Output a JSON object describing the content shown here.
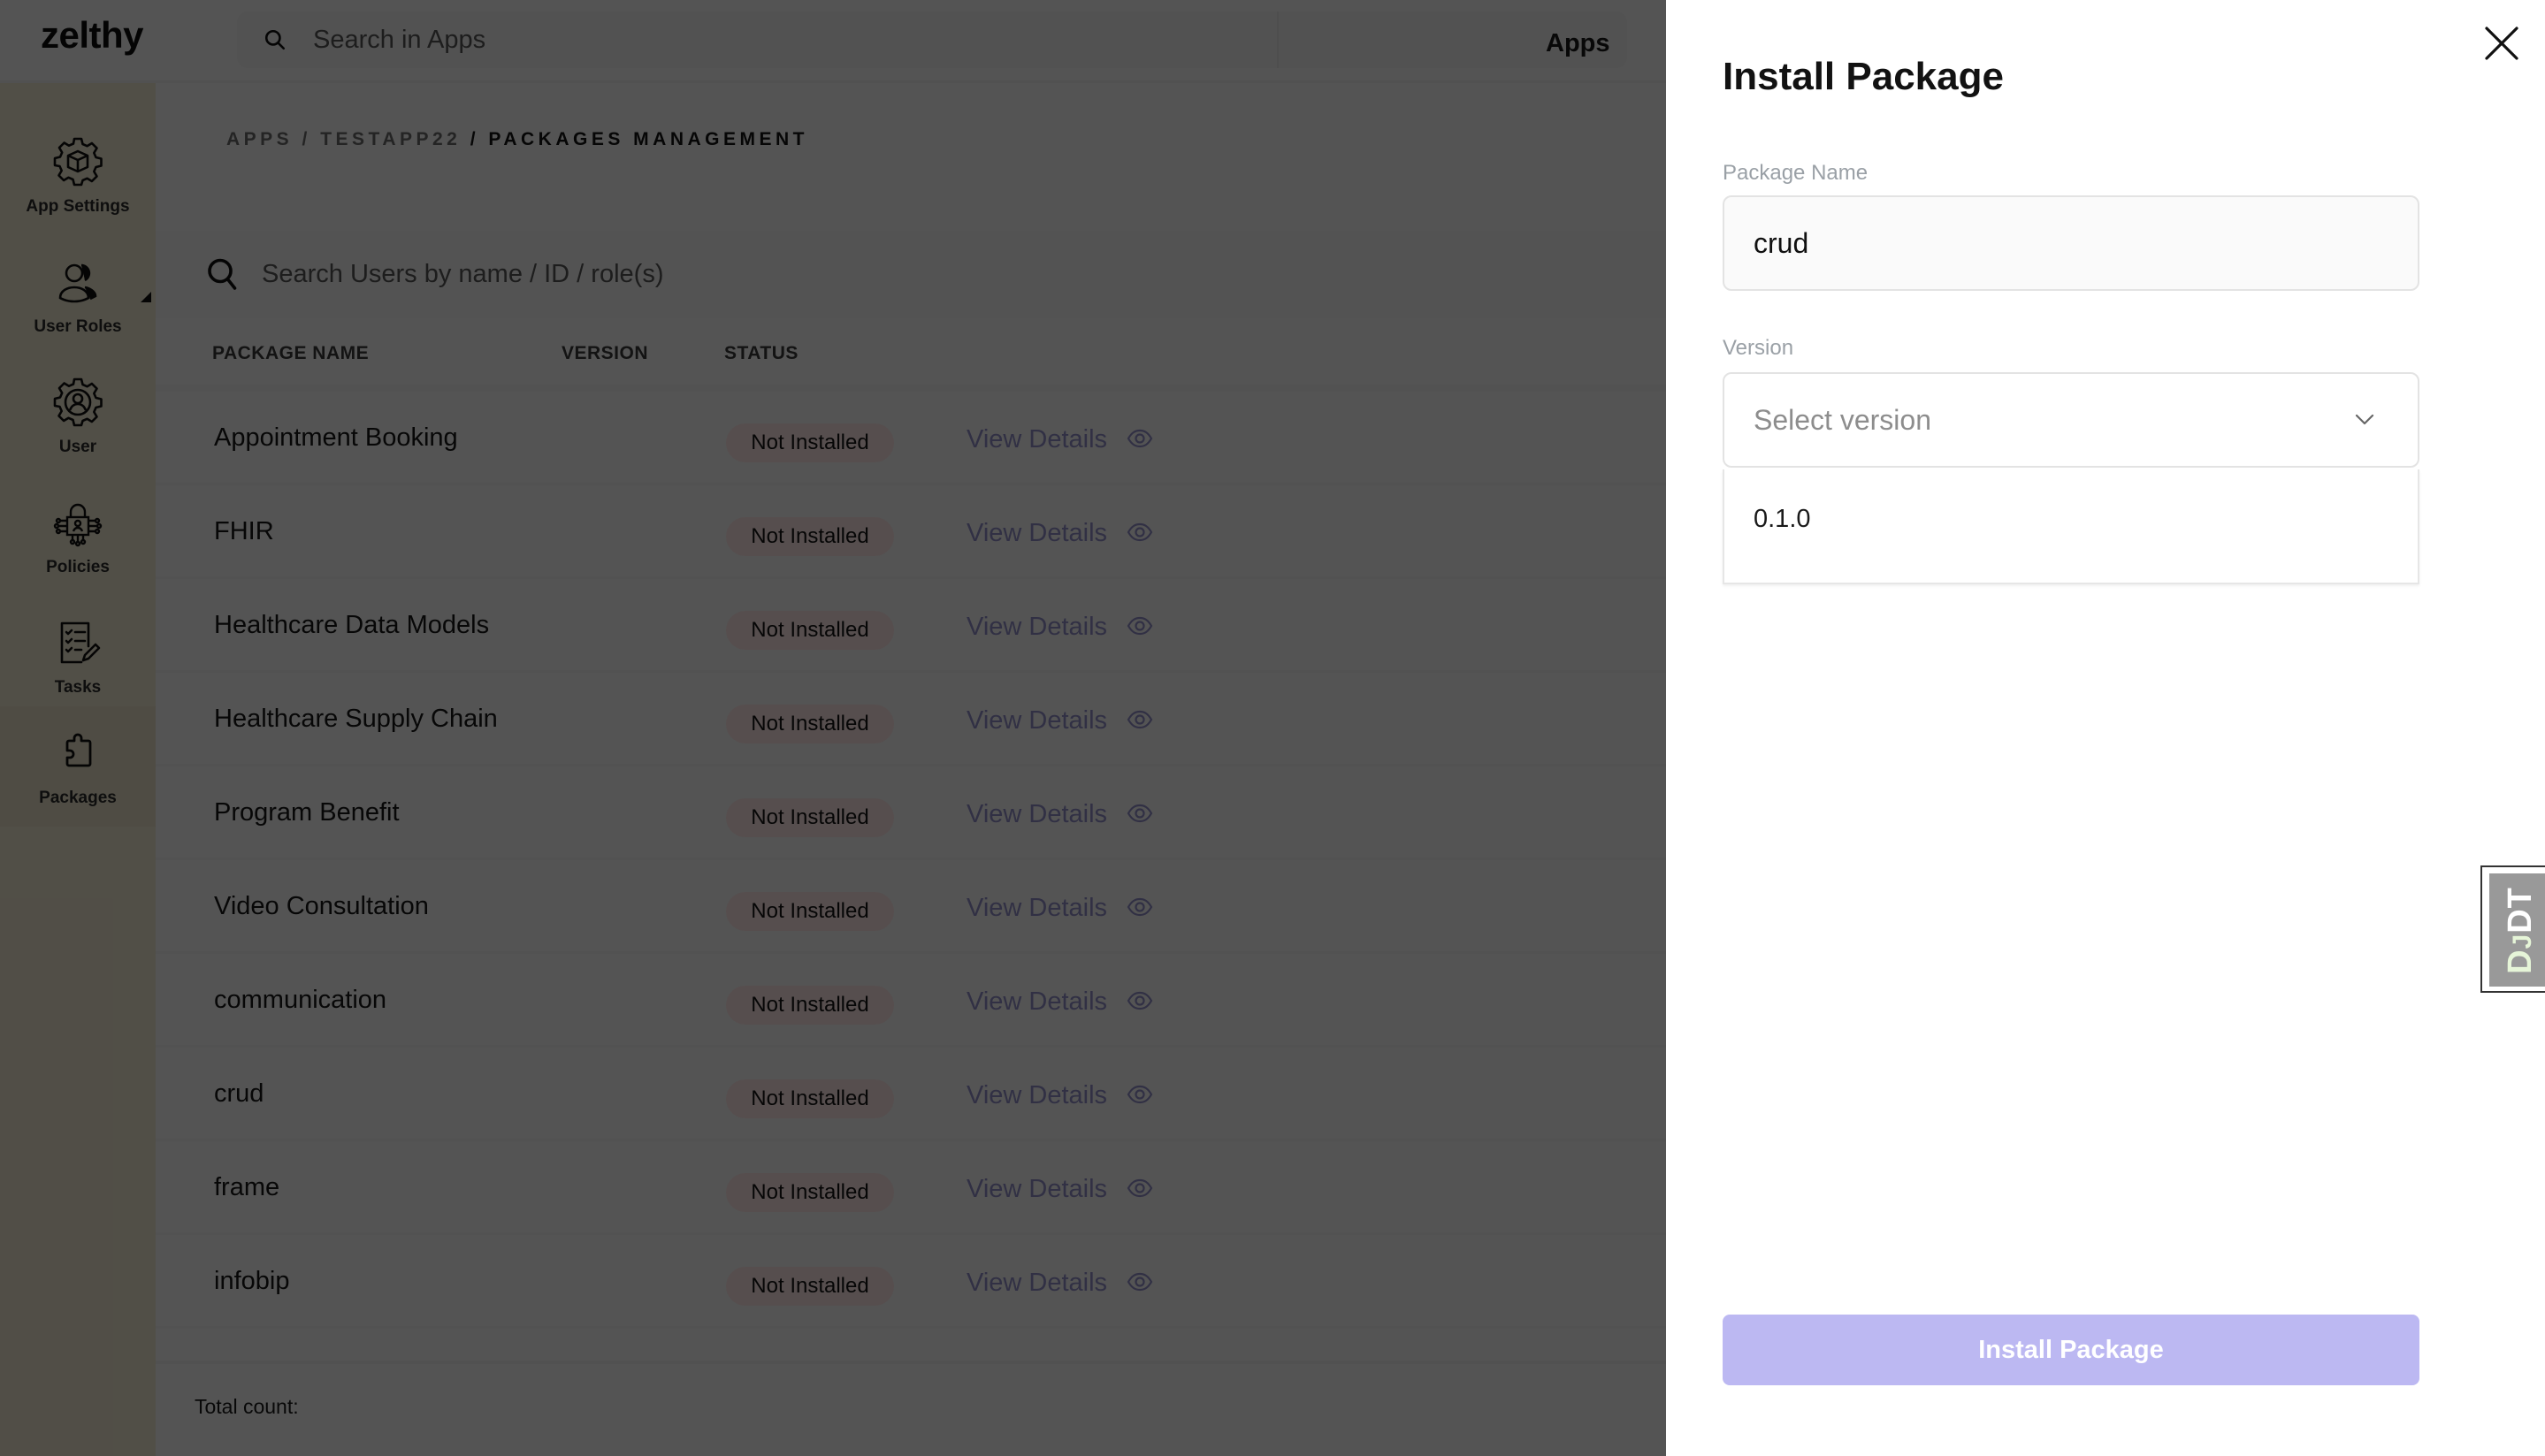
{
  "header": {
    "logo": "zelthy",
    "search_placeholder": "Search in Apps",
    "search_icon": "search-icon",
    "app_selector": {
      "value": "Apps",
      "icon": "chevron-down-icon"
    }
  },
  "sidebar": {
    "items": [
      {
        "label": "App Settings",
        "icon": "gear-cube-icon",
        "active": false
      },
      {
        "label": "User Roles",
        "icon": "user-roles-icon",
        "active": false
      },
      {
        "label": "User",
        "icon": "user-gear-icon",
        "active": false
      },
      {
        "label": "Policies",
        "icon": "policy-lock-icon",
        "active": false
      },
      {
        "label": "Tasks",
        "icon": "tasks-checklist-icon",
        "active": false
      },
      {
        "label": "Packages",
        "icon": "puzzle-piece-icon",
        "active": true
      }
    ]
  },
  "breadcrumb": {
    "items": [
      "APPS",
      "TESTAPP22"
    ],
    "separator": " / ",
    "current": "PACKAGES MANAGEMENT"
  },
  "table": {
    "search_placeholder": "Search Users by name / ID / role(s)",
    "columns": [
      "PACKAGE NAME",
      "VERSION",
      "STATUS"
    ],
    "rows": [
      {
        "name": "Appointment Booking",
        "version": "",
        "status": "Not Installed",
        "action": "View Details"
      },
      {
        "name": "FHIR",
        "version": "",
        "status": "Not Installed",
        "action": "View Details"
      },
      {
        "name": "Healthcare Data Models",
        "version": "",
        "status": "Not Installed",
        "action": "View Details"
      },
      {
        "name": "Healthcare Supply Chain",
        "version": "",
        "status": "Not Installed",
        "action": "View Details"
      },
      {
        "name": "Program Benefit",
        "version": "",
        "status": "Not Installed",
        "action": "View Details"
      },
      {
        "name": "Video Consultation",
        "version": "",
        "status": "Not Installed",
        "action": "View Details"
      },
      {
        "name": "communication",
        "version": "",
        "status": "Not Installed",
        "action": "View Details"
      },
      {
        "name": "crud",
        "version": "",
        "status": "Not Installed",
        "action": "View Details"
      },
      {
        "name": "frame",
        "version": "",
        "status": "Not Installed",
        "action": "View Details"
      },
      {
        "name": "infobip",
        "version": "",
        "status": "Not Installed",
        "action": "View Details"
      }
    ],
    "total_count_label": "Total count:"
  },
  "drawer": {
    "title": "Install Package",
    "package_name_label": "Package Name",
    "package_name_value": "crud",
    "version_label": "Version",
    "version_placeholder": "Select version",
    "version_options": [
      "0.1.0"
    ],
    "install_button": "Install Package",
    "close_icon": "close-icon"
  },
  "debug_toolbar": {
    "label_d": "D",
    "label_j": "J",
    "label_dt": "DT"
  },
  "colors": {
    "accent_disabled": "#bcb8f2",
    "badge_not_installed": "#fbe5e5",
    "link": "#8f8dc8",
    "sidebar": "#ede6d0"
  }
}
